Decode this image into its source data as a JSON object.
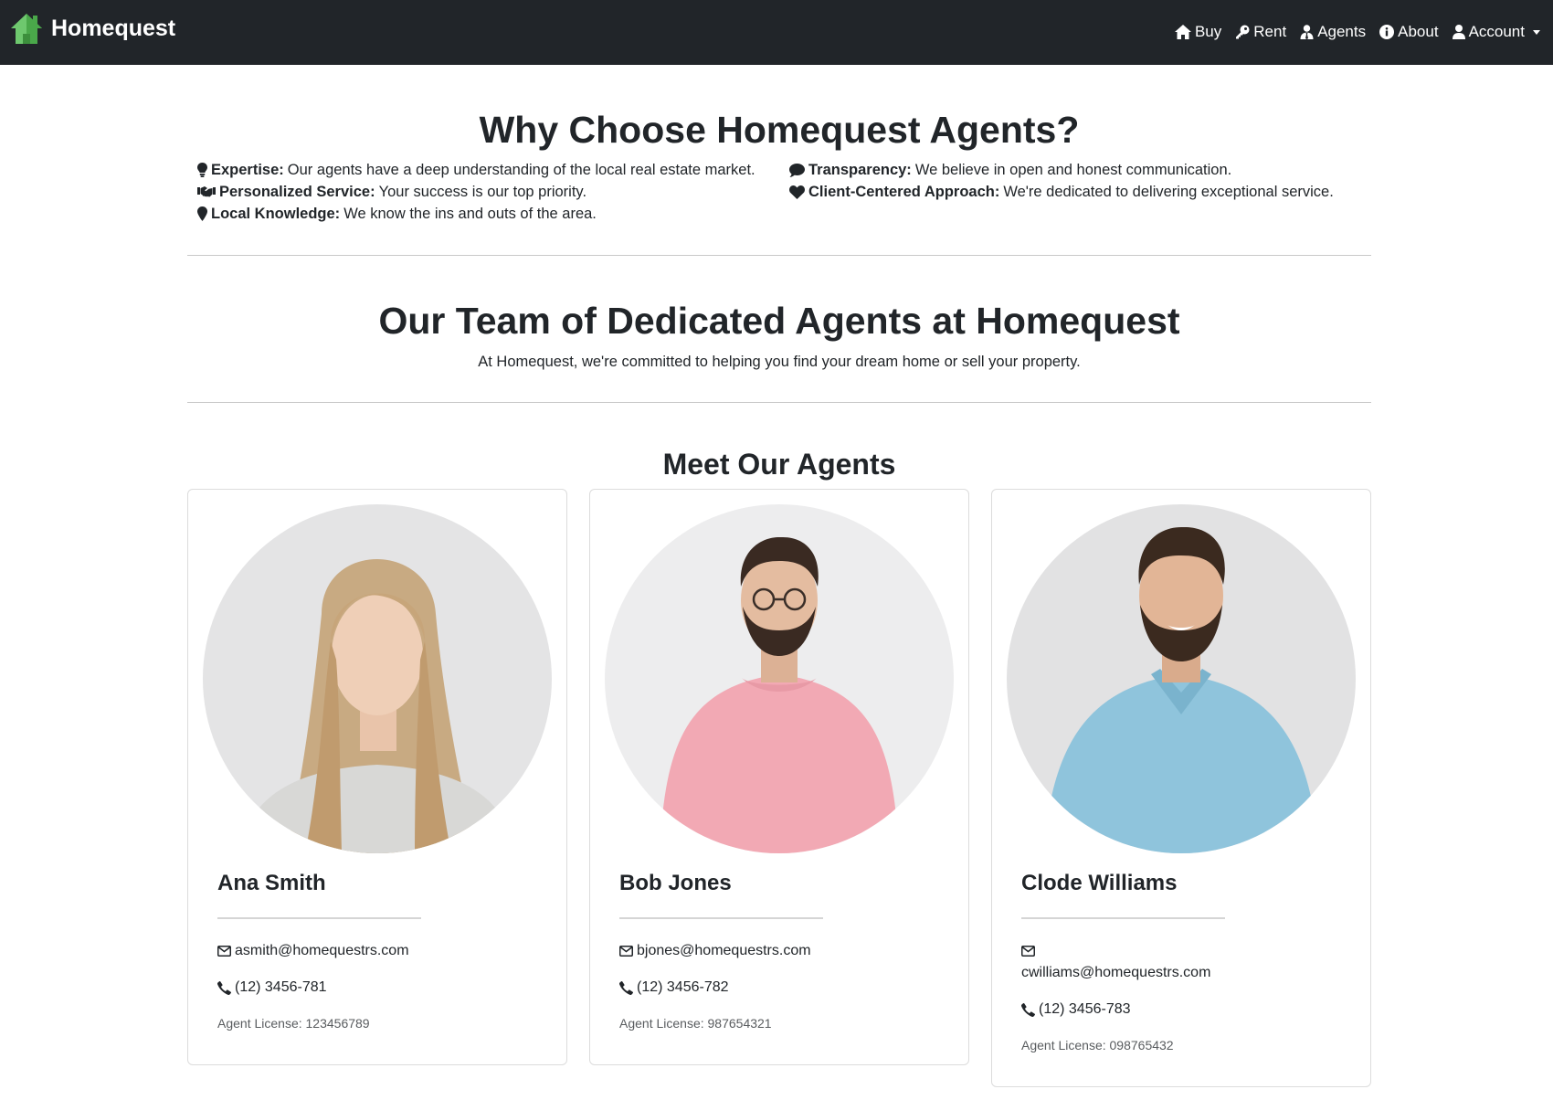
{
  "navbar": {
    "brand": "Homequest",
    "items": [
      {
        "label": "Buy",
        "icon": "home-icon"
      },
      {
        "label": "Rent",
        "icon": "key-icon"
      },
      {
        "label": "Agents",
        "icon": "agents-icon"
      },
      {
        "label": "About",
        "icon": "info-icon"
      },
      {
        "label": "Account",
        "icon": "user-icon"
      }
    ]
  },
  "why": {
    "title": "Why Choose Homequest Agents?",
    "features": [
      {
        "icon": "lightbulb-icon",
        "label": "Expertise:",
        "text": "Our agents have a deep understanding of the local real estate market."
      },
      {
        "icon": "handshake-icon",
        "label": "Personalized Service:",
        "text": "Your success is our top priority."
      },
      {
        "icon": "map-pin-icon",
        "label": "Local Knowledge:",
        "text": "We know the ins and outs of the area."
      },
      {
        "icon": "comment-icon",
        "label": "Transparency:",
        "text": "We believe in open and honest communication."
      },
      {
        "icon": "heart-icon",
        "label": "Client-Centered Approach:",
        "text": "We're dedicated to delivering exceptional service."
      }
    ]
  },
  "team": {
    "title": "Our Team of Dedicated Agents at Homequest",
    "subtitle": "At Homequest, we're committed to helping you find your dream home or sell your property."
  },
  "meet": {
    "title": "Meet Our Agents",
    "agents": [
      {
        "name": "Ana Smith",
        "email": "asmith@homequestrs.com",
        "phone": "(12) 3456-781",
        "license": "Agent License: 123456789"
      },
      {
        "name": "Bob Jones",
        "email": "bjones@homequestrs.com",
        "phone": "(12) 3456-782",
        "license": "Agent License: 987654321"
      },
      {
        "name": "Clode Williams",
        "email": "cwilliams@homequestrs.com",
        "phone": "(12) 3456-783",
        "license": "Agent License: 098765432"
      }
    ]
  },
  "colors": {
    "navbar_bg": "#212529",
    "brand_green": "#5cb85c",
    "text_dark": "#212529",
    "muted": "#595c5f"
  }
}
